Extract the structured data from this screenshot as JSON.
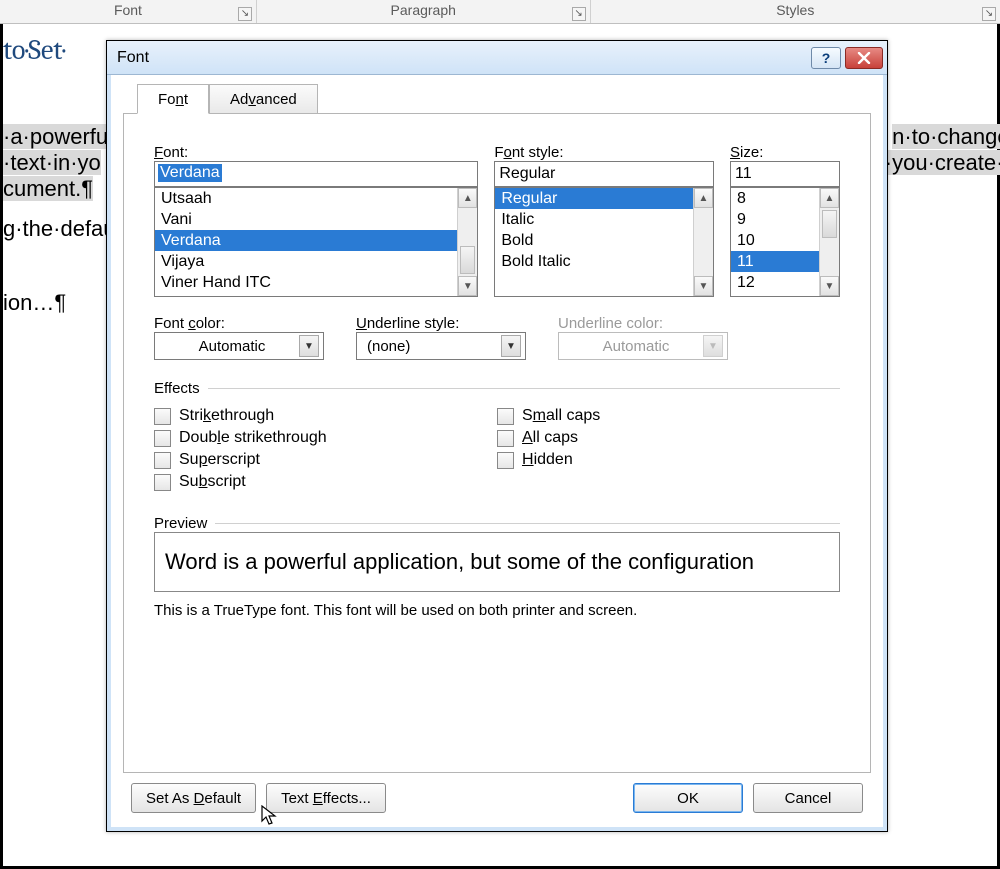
{
  "ribbon": {
    "groups": [
      "Font",
      "Paragraph",
      "Styles"
    ]
  },
  "doc": {
    "heading": "to·Set·",
    "line1a": "·a·powerfu",
    "line1b": "n·to·change·",
    "line2a": "·text·in·yo",
    "line2b": "·you·create·",
    "line3": "cument.¶",
    "line4": "g·the·defau",
    "line5": "ion…¶"
  },
  "dialog": {
    "title": "Font",
    "tabs": {
      "font": "Font",
      "advanced": "Advanced"
    },
    "labels": {
      "font": "Font:",
      "style": "Font style:",
      "size": "Size:",
      "color": "Font color:",
      "underline_style": "Underline style:",
      "underline_color": "Underline color:",
      "effects": "Effects",
      "preview": "Preview"
    },
    "font": {
      "value": "Verdana",
      "list": [
        "Utsaah",
        "Vani",
        "Verdana",
        "Vijaya",
        "Viner Hand ITC"
      ],
      "selected_index": 2
    },
    "style": {
      "value": "Regular",
      "list": [
        "Regular",
        "Italic",
        "Bold",
        "Bold Italic"
      ],
      "selected_index": 0
    },
    "size": {
      "value": "11",
      "list": [
        "8",
        "9",
        "10",
        "11",
        "12"
      ],
      "selected_index": 3
    },
    "color_value": "Automatic",
    "underline_style_value": "(none)",
    "underline_color_value": "Automatic",
    "effects": {
      "strikethrough": "Strikethrough",
      "double_strikethrough": "Double strikethrough",
      "superscript": "Superscript",
      "subscript": "Subscript",
      "small_caps": "Small caps",
      "all_caps": "All caps",
      "hidden": "Hidden"
    },
    "preview_text": "Word is a powerful application, but some of the configuration",
    "truetype_note": "This is a TrueType font. This font will be used on both printer and screen.",
    "buttons": {
      "set_default": "Set As Default",
      "text_effects": "Text Effects...",
      "ok": "OK",
      "cancel": "Cancel"
    }
  }
}
